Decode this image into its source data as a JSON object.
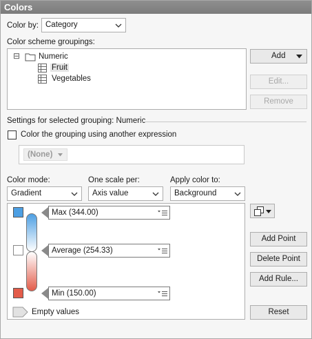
{
  "panel": {
    "title": "Colors"
  },
  "color_by": {
    "label": "Color by:",
    "value": "Category"
  },
  "groupings": {
    "label": "Color scheme groupings:",
    "root": {
      "expander": "⊟",
      "label": "Numeric"
    },
    "children": [
      {
        "label": "Fruit"
      },
      {
        "label": "Vegetables"
      }
    ],
    "add_button": "Add",
    "edit_button": "Edit...",
    "remove_button": "Remove"
  },
  "settings": {
    "header": "Settings for selected grouping: Numeric",
    "checkbox_label": "Color the grouping using another expression",
    "checkbox_checked": false,
    "expression_value": "(None)"
  },
  "color_mode": {
    "label": "Color mode:",
    "value": "Gradient"
  },
  "one_scale_per": {
    "label": "One scale per:",
    "value": "Axis value"
  },
  "apply_color_to": {
    "label": "Apply color to:",
    "value": "Background"
  },
  "gradient": {
    "points": [
      {
        "label": "Max (344.00)",
        "color": "#4d9fe3"
      },
      {
        "label": "Average (254.33)",
        "color": "#ffffff"
      },
      {
        "label": "Min (150.00)",
        "color": "#e35c4a"
      }
    ],
    "empty_values_label": "Empty values",
    "empty_color": "#e2e2e2"
  },
  "buttons": {
    "add_point": "Add Point",
    "delete_point": "Delete Point",
    "add_rule": "Add Rule...",
    "reset": "Reset"
  }
}
